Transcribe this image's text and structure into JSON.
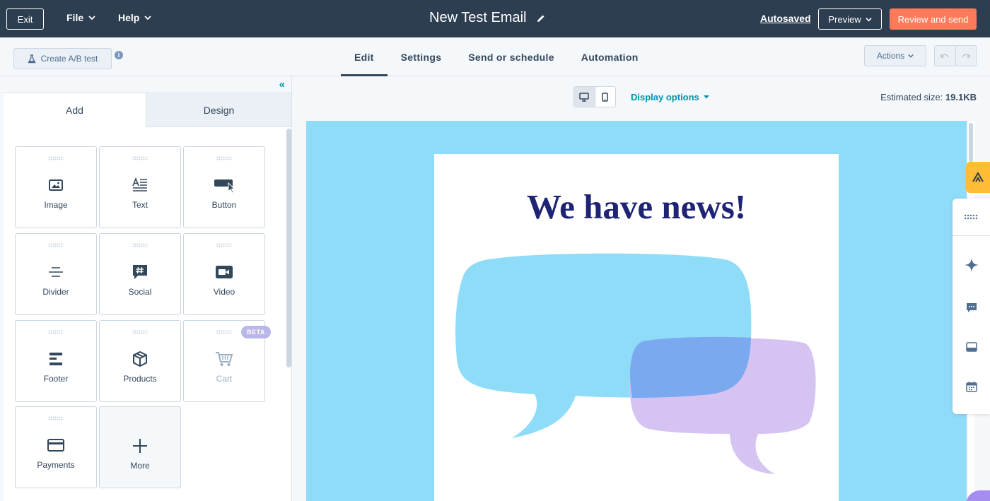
{
  "topbar": {
    "exit_label": "Exit",
    "menus": [
      {
        "label": "File"
      },
      {
        "label": "Help"
      }
    ],
    "email_title": "New Test Email",
    "autosaved_label": "Autosaved",
    "preview_label": "Preview",
    "review_label": "Review and send"
  },
  "subbar": {
    "ab_test_label": "Create A/B test",
    "tabs": [
      {
        "label": "Edit",
        "active": true
      },
      {
        "label": "Settings"
      },
      {
        "label": "Send or schedule"
      },
      {
        "label": "Automation"
      }
    ],
    "actions_label": "Actions"
  },
  "left_panel": {
    "tabs": [
      {
        "label": "Add",
        "active": true
      },
      {
        "label": "Design"
      }
    ],
    "modules": [
      {
        "label": "Image",
        "icon": "image-icon"
      },
      {
        "label": "Text",
        "icon": "text-icon"
      },
      {
        "label": "Button",
        "icon": "button-icon"
      },
      {
        "label": "Divider",
        "icon": "divider-icon"
      },
      {
        "label": "Social",
        "icon": "social-icon"
      },
      {
        "label": "Video",
        "icon": "video-icon"
      },
      {
        "label": "Footer",
        "icon": "footer-icon"
      },
      {
        "label": "Products",
        "icon": "products-icon"
      },
      {
        "label": "Cart",
        "icon": "cart-icon",
        "disabled": true,
        "badge": "BETA"
      },
      {
        "label": "Payments",
        "icon": "payments-icon"
      },
      {
        "label": "More",
        "icon": "plus-icon"
      }
    ]
  },
  "canvas": {
    "display_options_label": "Display options",
    "estimated_size_label": "Estimated size:",
    "estimated_size_value": "19.1KB",
    "email": {
      "headline": "We have news!",
      "background_color": "#8fdcf8",
      "headline_color": "#1e2473"
    }
  },
  "colors": {
    "topbar": "#2d3e50",
    "accent_orange": "#ff7a59",
    "link_teal": "#0091ae"
  }
}
